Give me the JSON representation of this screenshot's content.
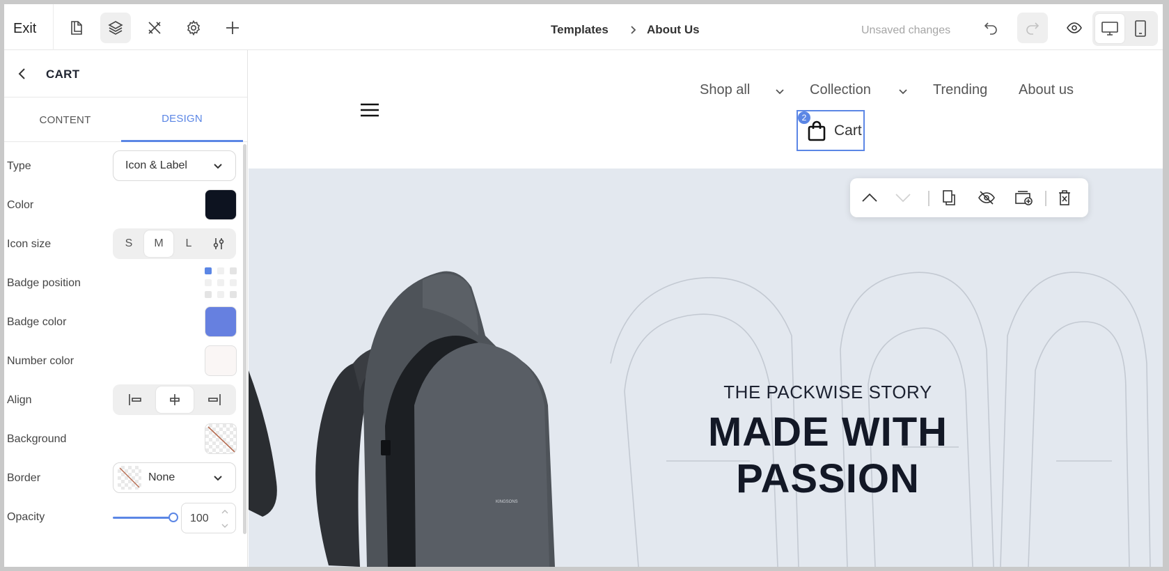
{
  "toolbar": {
    "exit_label": "Exit",
    "icons": [
      "pages-icon",
      "layers-icon",
      "tools-icon",
      "gear-icon",
      "plus-icon"
    ],
    "breadcrumb": {
      "parent": "Templates",
      "current": "About Us"
    },
    "status": "Unsaved changes",
    "devices": [
      "desktop",
      "tablet"
    ]
  },
  "panel": {
    "title": "CART",
    "tabs": [
      {
        "label": "CONTENT"
      },
      {
        "label": "DESIGN"
      }
    ],
    "active_tab": "DESIGN",
    "fields": {
      "type": {
        "label": "Type",
        "value": "Icon & Label"
      },
      "color": {
        "label": "Color",
        "value": "#0d1320"
      },
      "icon_size": {
        "label": "Icon size",
        "options": [
          "S",
          "M",
          "L"
        ],
        "selected": "M"
      },
      "badge_position": {
        "label": "Badge position",
        "selected": "top-left"
      },
      "badge_color": {
        "label": "Badge color",
        "value": "#6680e0"
      },
      "number_color": {
        "label": "Number color",
        "value": "#faf6f5"
      },
      "align": {
        "label": "Align",
        "options": [
          "left",
          "center",
          "right"
        ],
        "selected": "center"
      },
      "background": {
        "label": "Background",
        "value": "none"
      },
      "border": {
        "label": "Border",
        "value": "None"
      },
      "opacity": {
        "label": "Opacity",
        "value": "100"
      }
    }
  },
  "site": {
    "nav": {
      "links": [
        {
          "label": "Shop all",
          "dropdown": true
        },
        {
          "label": "Collection",
          "dropdown": true
        },
        {
          "label": "Trending",
          "dropdown": false
        },
        {
          "label": "About us",
          "dropdown": false
        }
      ],
      "cart": {
        "label": "Cart",
        "badge": "2"
      }
    },
    "hero": {
      "kicker": "THE PACKWISE STORY",
      "headline": "MADE WITH PASSION",
      "product_brand": "KINGSONS"
    }
  },
  "floating_toolbar": [
    "move-up",
    "move-down",
    "duplicate",
    "hide",
    "add-section",
    "delete"
  ],
  "colors": {
    "accent": "#5b86e5",
    "hero_bg": "#e3e8ef"
  }
}
